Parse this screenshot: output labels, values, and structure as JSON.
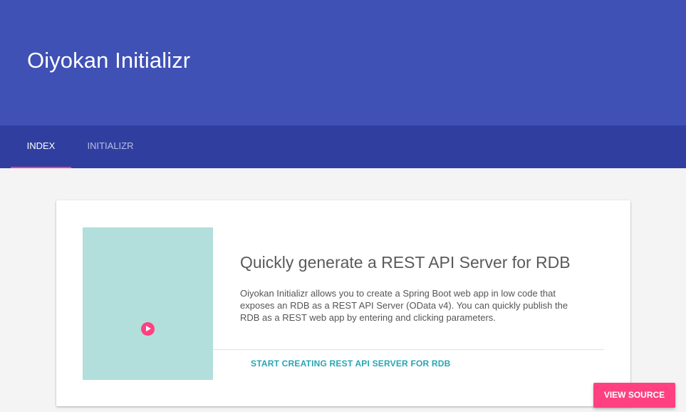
{
  "header": {
    "title": "Oiyokan Initializr",
    "background_color": "#3f51b5"
  },
  "tabs": {
    "background_color": "#303f9f",
    "indicator_color": "#ff4081",
    "active": "INDEX",
    "items": [
      {
        "label": "INDEX"
      },
      {
        "label": "INITIALIZR"
      }
    ]
  },
  "card": {
    "media_color": "#b2dfdb",
    "media_icon": "play-icon",
    "title": "Quickly generate a REST API Server for RDB",
    "description": "Oiyokan Initializr allows you to create a Spring Boot web app in low code that exposes an RDB as a REST API Server (OData v4). You can quickly publish the RDB as a REST web app by entering and clicking parameters.",
    "action_label": "START CREATING REST API SERVER FOR RDB",
    "action_color": "#26a6b4"
  },
  "fab": {
    "label": "VIEW SOURCE",
    "color": "#ff4081"
  }
}
